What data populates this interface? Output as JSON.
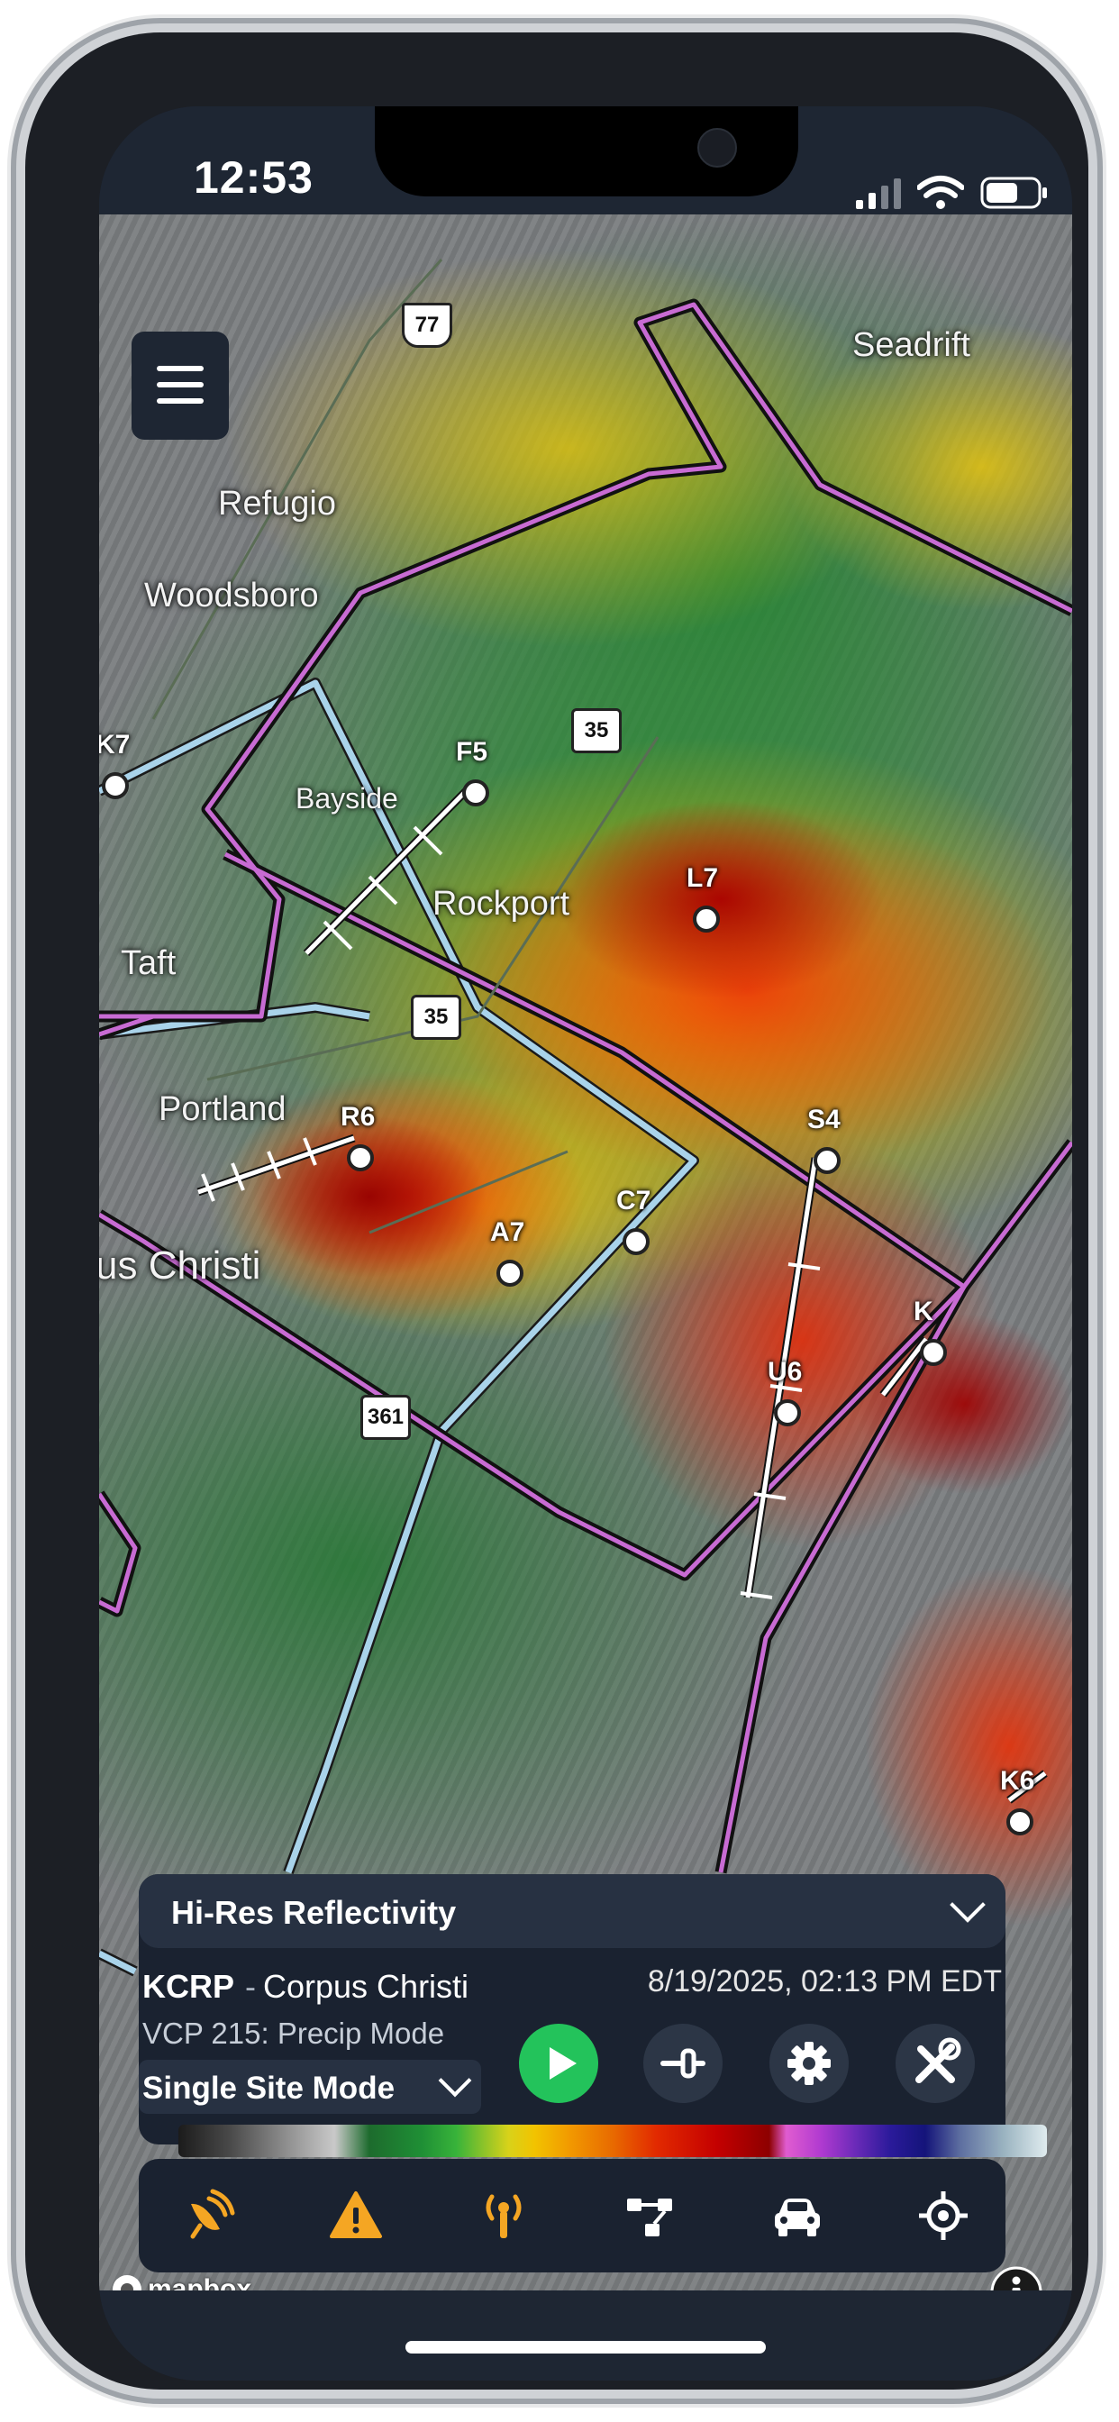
{
  "status_bar": {
    "time": "12:53"
  },
  "map": {
    "labels": {
      "seadrift": "Seadrift",
      "refugio": "Refugio",
      "woodsboro": "Woodsboro",
      "bayside": "Bayside",
      "rockport": "Rockport",
      "taft": "Taft",
      "portland": "Portland",
      "corpus_christi": "us Christi"
    },
    "route_shields": [
      "77",
      "35",
      "35",
      "361"
    ],
    "storm_ids": [
      "K7",
      "F5",
      "L7",
      "R6",
      "A7",
      "C7",
      "S4",
      "U6",
      "K",
      "K6"
    ]
  },
  "panel": {
    "product": "Hi-Res Reflectivity",
    "station_code": "KCRP",
    "station_separator": "-",
    "station_name": "Corpus Christi",
    "scan_time": "8/19/2025, 02:13 PM EDT",
    "vcp_mode": "VCP 215: Precip Mode",
    "site_mode": "Single Site Mode"
  },
  "toolbar": {
    "icons": [
      "radar-icon",
      "warning-icon",
      "antenna-icon",
      "network-icon",
      "car-icon",
      "crosshair-icon"
    ]
  },
  "attribution": {
    "mapbox": "mapbox"
  },
  "colors": {
    "accent_orange": "#f5a623",
    "play_green": "#23c35b",
    "panel_bg": "#1a2230",
    "warning_polygon": "#6a1b6f",
    "county_line": "#a9d3ea"
  }
}
